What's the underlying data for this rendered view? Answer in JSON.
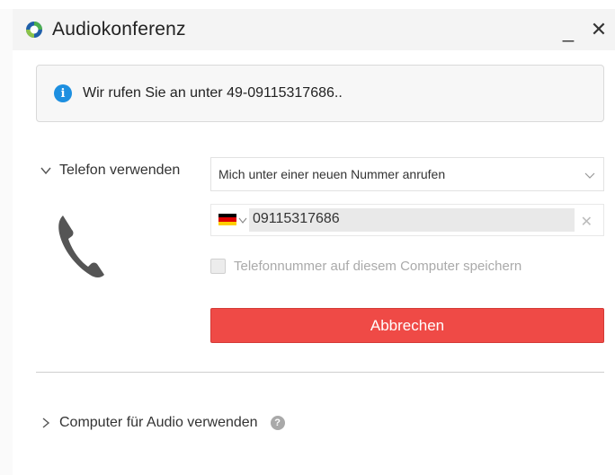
{
  "window": {
    "title": "Audiokonferenz",
    "minimize_glyph": "_",
    "close_glyph": "✕"
  },
  "info": {
    "message": "Wir rufen Sie an unter 49-09115317686.."
  },
  "phone_section": {
    "label": "Telefon verwenden",
    "call_option": {
      "selected": "Mich unter einer neuen Nummer anrufen"
    },
    "phone_number": "09115317686",
    "country_flag": "germany-flag",
    "save_checkbox": {
      "label": "Telefonnummer auf diesem Computer speichern",
      "checked": false
    },
    "cancel_label": "Abbrechen"
  },
  "computer_section": {
    "label": "Computer für Audio verwenden"
  },
  "colors": {
    "accent_info": "#1d8fe0",
    "cancel_button": "#ef4a46",
    "app_icon_green": "#4caf50",
    "app_icon_blue": "#1f5fa8"
  }
}
